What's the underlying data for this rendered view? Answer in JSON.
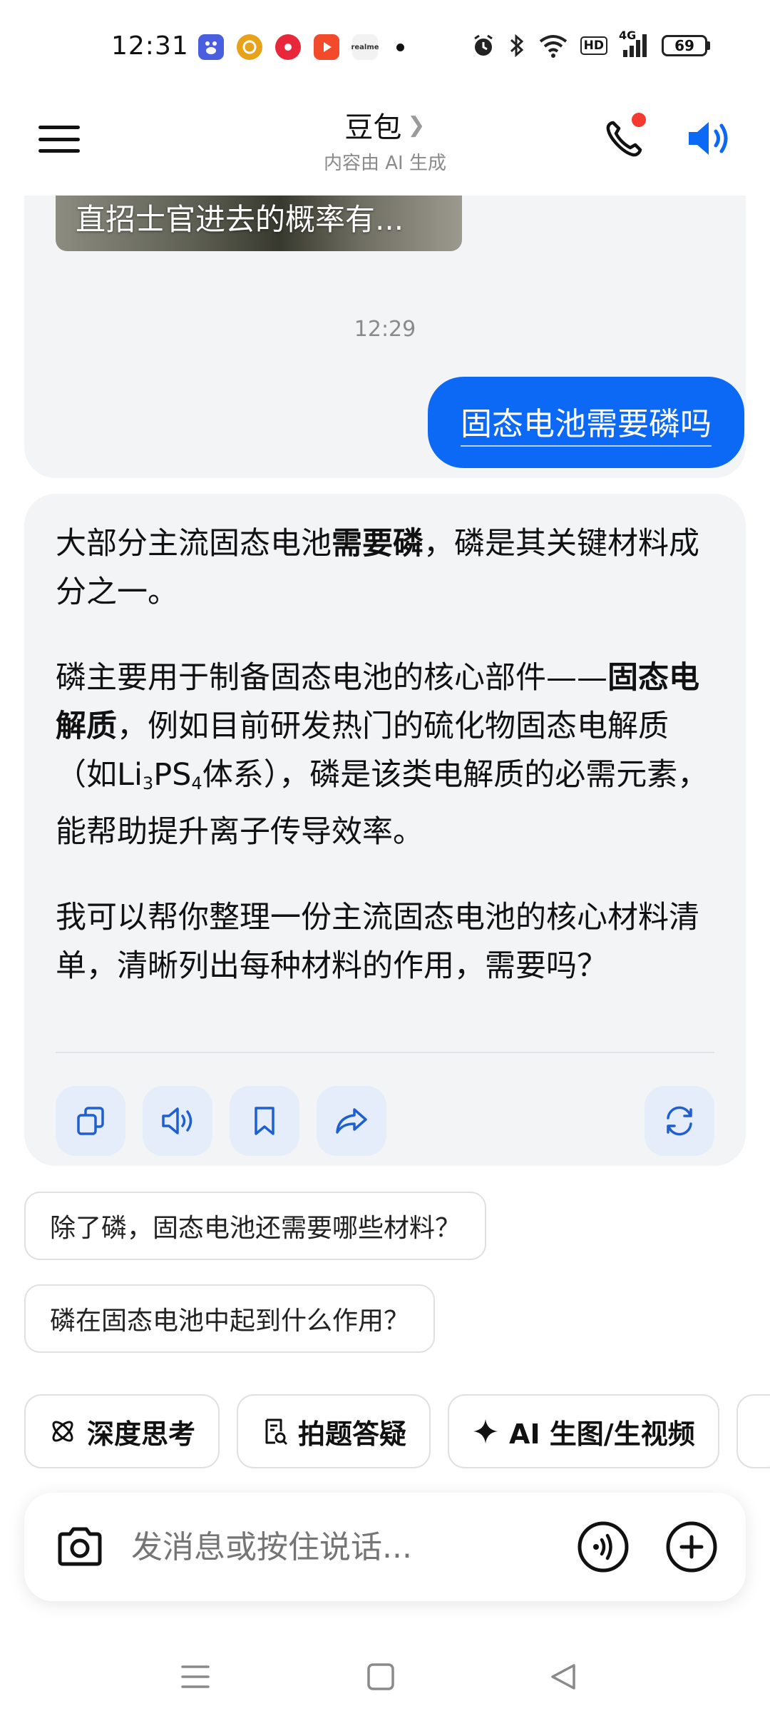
{
  "status_bar": {
    "time": "12:31",
    "battery": "69",
    "network": "4G",
    "hd": "HD",
    "notif_labels": [
      "du",
      "e",
      "",
      "",
      "realme"
    ]
  },
  "header": {
    "title": "豆包",
    "subtitle": "内容由 AI 生成",
    "chevron": "❯"
  },
  "chat": {
    "prev_caption": "直招士官进去的概率有...",
    "time_separator": "12:29",
    "user_message": "固态电池需要磷吗",
    "ai_p1_a": "大部分主流固态电池",
    "ai_p1_b": "需要磷",
    "ai_p1_c": "，磷是其关键材料成分之一。",
    "ai_p2_a": "磷主要用于制备固态电池的核心部件——",
    "ai_p2_b": "固态电解质",
    "ai_p2_c": "，例如目前研发热门的硫化物固态电解质（如Li",
    "ai_p2_sub1": "3",
    "ai_p2_d": "PS",
    "ai_p2_sub2": "4",
    "ai_p2_e": "体系），磷是该类电解质的必需元素，能帮助提升离子传导效率。",
    "ai_p3": "我可以帮你整理一份主流固态电池的核心材料清单，清晰列出每种材料的作用，需要吗？",
    "actions": [
      "copy-icon",
      "read-aloud-icon",
      "bookmark-icon",
      "share-icon",
      "regenerate-icon"
    ],
    "suggestions": [
      "除了磷，固态电池还需要哪些材料？",
      "磷在固态电池中起到什么作用？"
    ]
  },
  "tools": {
    "chips": [
      "深度思考",
      "拍题答疑",
      "AI 生图/生视频"
    ]
  },
  "input": {
    "placeholder": "发消息或按住说话..."
  },
  "colors": {
    "accent": "#0b69f5",
    "card_bg": "#f3f4f6",
    "action_bg": "#e5edfb",
    "notif_red": "#f53a2f"
  }
}
